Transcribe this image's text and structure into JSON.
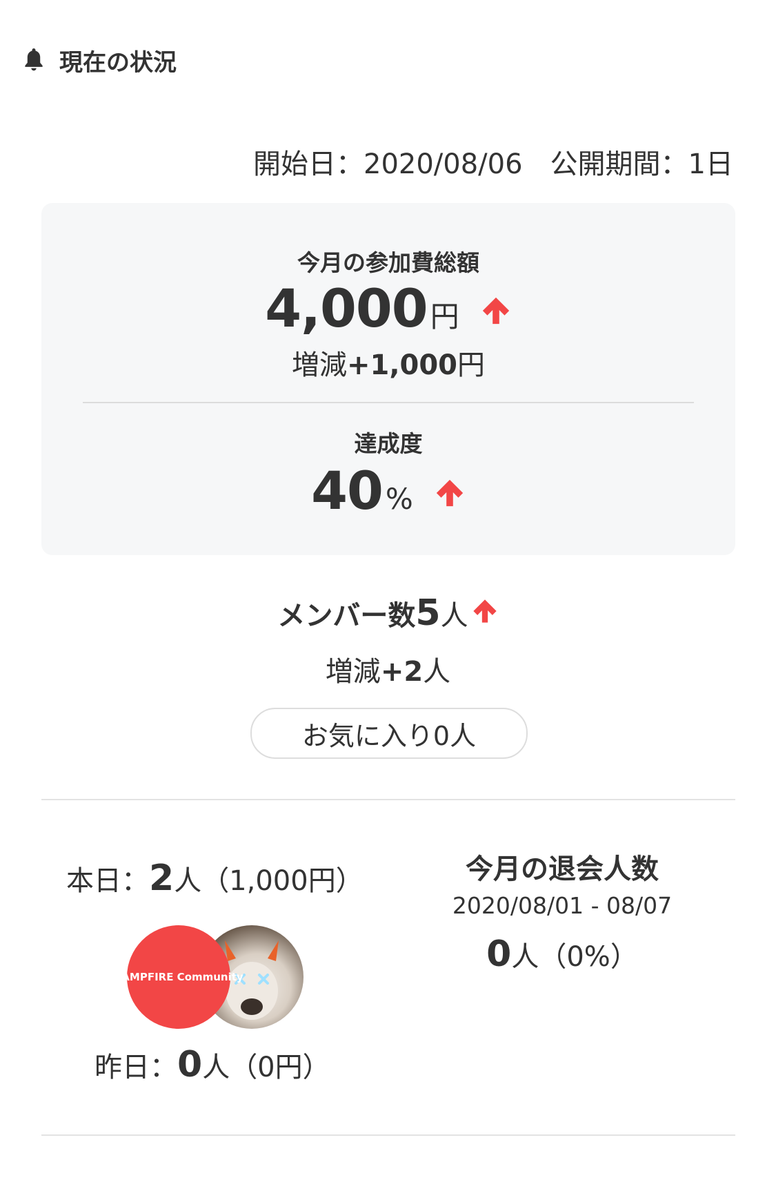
{
  "header": {
    "title": "現在の状況",
    "icon": "bell-icon"
  },
  "meta": {
    "start_date": "開始日：2020/08/06",
    "public_period": "公開期間：1日"
  },
  "fees": {
    "label": "今月の参加費総額",
    "amount": "4,000",
    "unit": "円",
    "delta_prefix": "増減",
    "delta_value": "+1,000",
    "delta_unit": "円",
    "trend": "up"
  },
  "achievement": {
    "label": "達成度",
    "value": "40",
    "unit": "%",
    "trend": "up"
  },
  "members": {
    "label": "メンバー数",
    "count": "5",
    "unit": "人",
    "trend": "up",
    "delta_prefix": "増減",
    "delta_value": "+2",
    "delta_unit": "人"
  },
  "favorites": {
    "label": "お気に入り0人"
  },
  "today": {
    "label": "本日：",
    "count": "2",
    "unit": "人",
    "amount": "（1,000円）"
  },
  "avatars": [
    {
      "name": "campfire-community-avatar",
      "text": "CAMPFIRE Community"
    },
    {
      "name": "dog-avatar"
    }
  ],
  "yesterday": {
    "label": "昨日：",
    "count": "0",
    "unit": "人",
    "amount": "（0円）"
  },
  "leave": {
    "title": "今月の退会人数",
    "range": "2020/08/01 - 08/07",
    "count": "0",
    "unit": "人",
    "percent": "（0%）"
  },
  "colors": {
    "accent": "#f24646",
    "card_bg": "#f6f7f8",
    "text": "#333333"
  }
}
